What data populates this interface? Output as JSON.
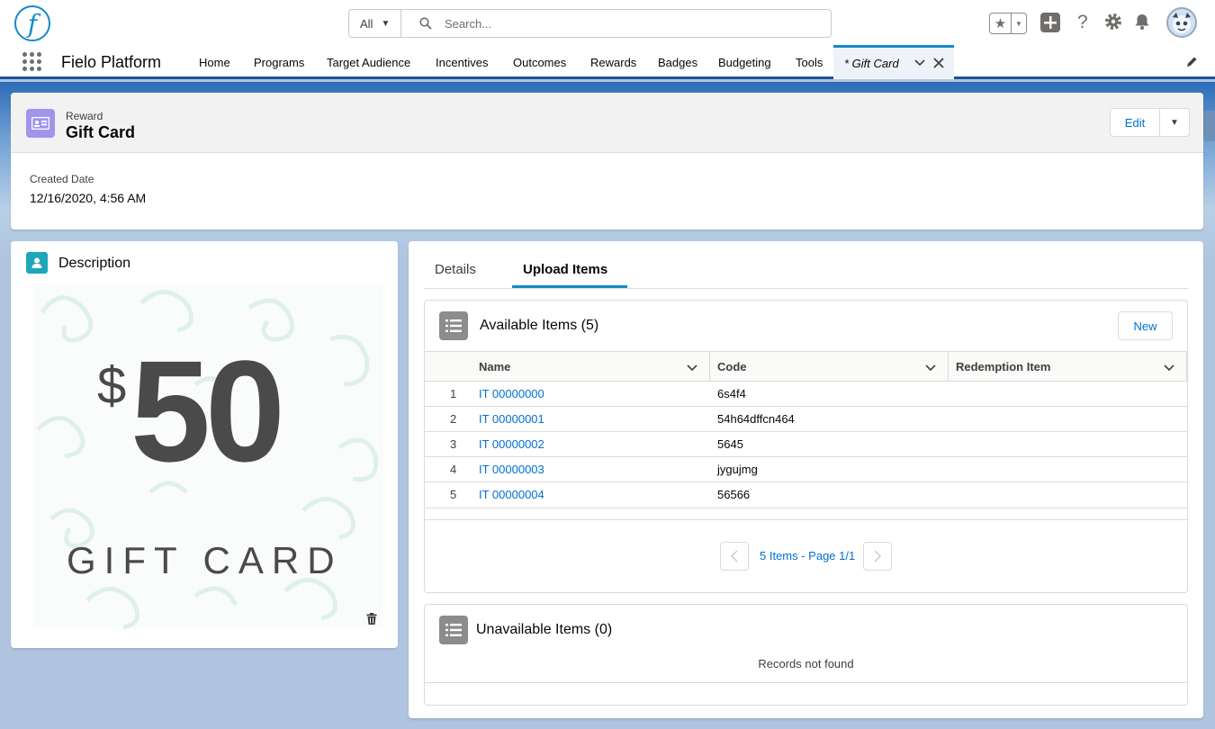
{
  "search": {
    "scope": "All",
    "placeholder": "Search..."
  },
  "nav": {
    "app_name": "Fielo Platform",
    "items": [
      "Home",
      "Programs",
      "Target Audience",
      "Incentives",
      "Outcomes",
      "Rewards",
      "Badges",
      "Budgeting",
      "Tools"
    ],
    "active_tab": "* Gift Card"
  },
  "record": {
    "type": "Reward",
    "name": "Gift Card",
    "edit_label": "Edit",
    "created_label": "Created Date",
    "created_value": "12/16/2020, 4:56 AM"
  },
  "description": {
    "title": "Description",
    "image": {
      "dollar": "$",
      "amount": "50",
      "label": "GIFT CARD"
    }
  },
  "tabs": [
    "Details",
    "Upload Items"
  ],
  "available": {
    "title": "Available Items (5)",
    "new_label": "New",
    "columns": [
      "Name",
      "Code",
      "Redemption Item"
    ],
    "rows": [
      {
        "num": "1",
        "name": "IT 00000000",
        "code": "6s4f4"
      },
      {
        "num": "2",
        "name": "IT 00000001",
        "code": "54h64dffcn464"
      },
      {
        "num": "3",
        "name": "IT 00000002",
        "code": "5645"
      },
      {
        "num": "4",
        "name": "IT 00000003",
        "code": "jygujmg"
      },
      {
        "num": "5",
        "name": "IT 00000004",
        "code": "56566"
      }
    ],
    "pager": "5 Items - Page 1/1"
  },
  "unavailable": {
    "title": "Unavailable Items (0)",
    "empty": "Records not found"
  },
  "colors": {
    "brand": "#1589c8",
    "link": "#0070d2",
    "reward_icon": "#a094ed",
    "desc_icon": "#1fa6b8"
  }
}
